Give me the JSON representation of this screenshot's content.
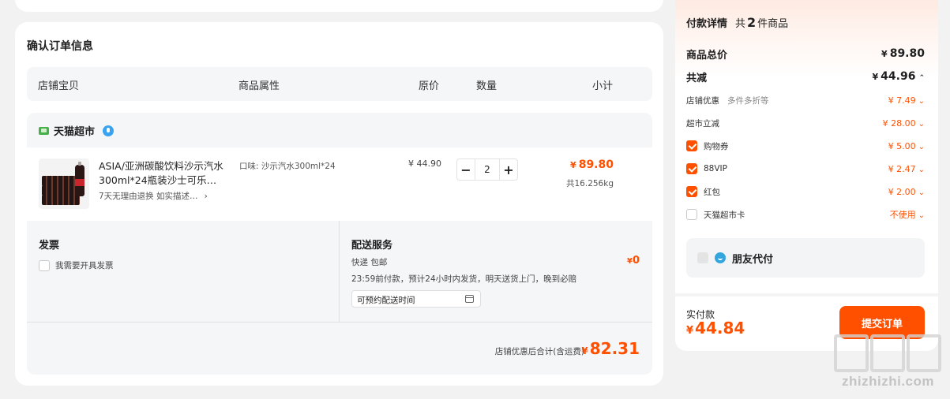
{
  "main": {
    "title": "确认订单信息",
    "columns": [
      "店铺宝贝",
      "商品属性",
      "原价",
      "数量",
      "小计"
    ],
    "shop": {
      "name": "天猫超市"
    },
    "item": {
      "title": "ASIA/亚洲碳酸饮料沙示汽水300ml*24瓶装沙士可乐…",
      "tags": "7天无理由退换   如实描述…",
      "spec": "口味: 沙示汽水300ml*24",
      "price": "¥ 44.90",
      "qty_minus": "−",
      "qty": "2",
      "qty_plus": "+",
      "subtotal_currency": "¥",
      "subtotal": "89.80",
      "weight": "共16.256kg"
    },
    "invoice": {
      "title": "发票",
      "checkbox_label": "我需要开具发票"
    },
    "delivery": {
      "title": "配送服务",
      "method": "快递 包邮",
      "note": "23:59前付款，预计24小时内发货，明天送货上门，晚到必赔",
      "time_placeholder": "可预约配送时间",
      "fee_currency": "¥",
      "fee": "0"
    },
    "shop_total": {
      "label": "店铺优惠后合计(含运费)",
      "currency": "¥",
      "value": "82.31"
    }
  },
  "side": {
    "title": "付款详情",
    "count_prefix": "共",
    "count": "2",
    "count_suffix": "件商品",
    "total_label": "商品总价",
    "total_currency": "¥",
    "total_value": "89.80",
    "discount_label": "共减",
    "discount_currency": "¥",
    "discount_value": "44.96",
    "discount_toggle": "⌃",
    "rows": [
      {
        "label": "店铺优惠",
        "hint": "多件多折等",
        "value": "¥ 7.49",
        "caret": "⌄"
      },
      {
        "label": "超市立减",
        "value": "¥ 28.00",
        "caret": "⌄"
      },
      {
        "label": "购物券",
        "checked": true,
        "value": "¥ 5.00",
        "caret": "⌄"
      },
      {
        "label": "88VIP",
        "checked": true,
        "value": "¥ 2.47",
        "caret": "⌄"
      },
      {
        "label": "红包",
        "checked": true,
        "value": "¥ 2.00",
        "caret": "⌄"
      },
      {
        "label": "天猫超市卡",
        "checked": false,
        "value": "不使用",
        "caret": "⌄"
      }
    ],
    "friend_pay": "朋友代付",
    "pay_label": "实付款",
    "pay_currency": "¥",
    "pay_value": "44.84",
    "submit": "提交订单"
  },
  "watermark": {
    "text": "zhizhizhi.com"
  },
  "colors": {
    "accent": "#ff5000",
    "panel": "#f5f6f8",
    "background": "#f2f2f2"
  },
  "icons": [
    "tmall-logo-icon",
    "shop-badge-icon",
    "chevron-right-icon",
    "calendar-icon",
    "chevron-down-icon",
    "chevron-up-icon",
    "friend-pay-icon"
  ]
}
